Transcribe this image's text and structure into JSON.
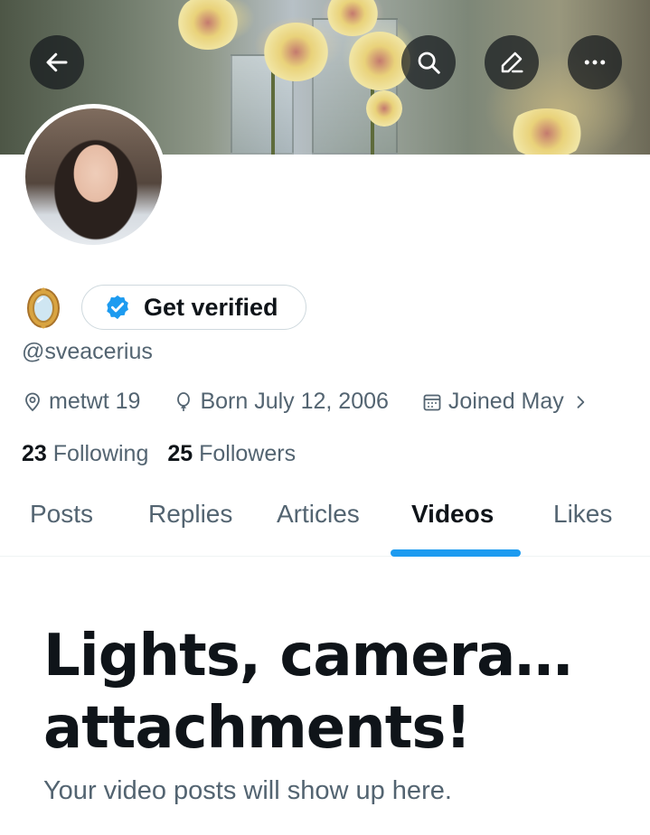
{
  "banner": {
    "alt": ""
  },
  "header": {
    "back_icon": "arrow-left-icon",
    "search_icon": "search-icon",
    "edit_icon": "pencil-icon",
    "more_icon": "more-horizontal-icon"
  },
  "profile": {
    "name_emoji": "mirror-icon",
    "verify_label": "Get verified",
    "handle": "@sveacerius",
    "location": "metwt 19",
    "birthday": "Born July 12, 2006",
    "joined": "Joined May",
    "following_count": "23",
    "following_label": "Following",
    "followers_count": "25",
    "followers_label": "Followers"
  },
  "tabs": [
    {
      "label": "Posts",
      "active": false
    },
    {
      "label": "Replies",
      "active": false
    },
    {
      "label": "Articles",
      "active": false
    },
    {
      "label": "Videos",
      "active": true
    },
    {
      "label": "Likes",
      "active": false
    }
  ],
  "empty_state": {
    "title_line1": "Lights, camera…",
    "title_line2": "attachments!",
    "subtitle": "Your video posts will show up here."
  },
  "colors": {
    "accent": "#1d9bf0",
    "text_primary": "#0f1419",
    "text_secondary": "#536471"
  }
}
